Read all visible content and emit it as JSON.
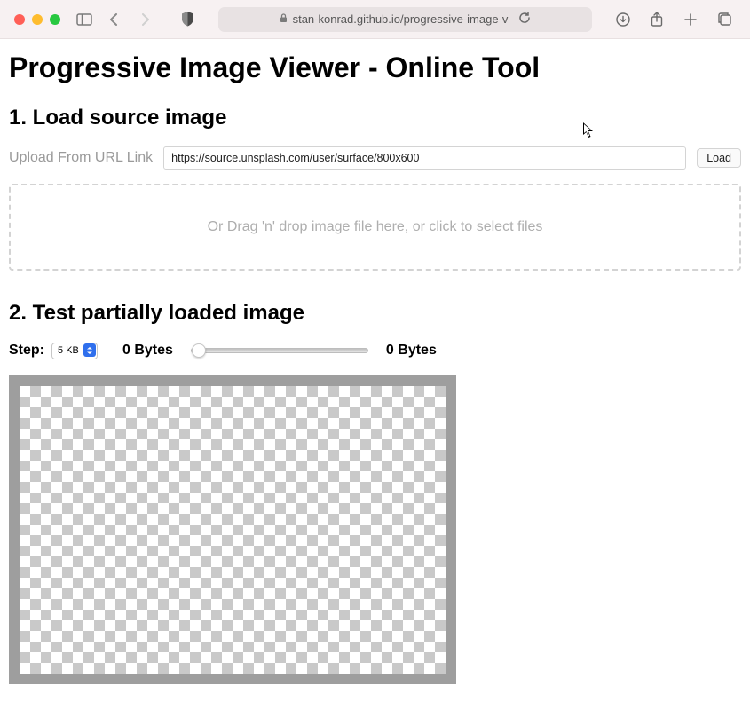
{
  "chrome": {
    "url_display": "stan-konrad.github.io/progressive-image-v"
  },
  "page": {
    "title": "Progressive Image Viewer - Online Tool",
    "section1": {
      "heading": "1. Load source image",
      "url_label": "Upload From URL Link",
      "url_value": "https://source.unsplash.com/user/surface/800x600",
      "load_button": "Load",
      "dropzone_text": "Or Drag 'n' drop image file here, or click to select files"
    },
    "section2": {
      "heading": "2. Test partially loaded image",
      "step_label": "Step:",
      "step_value": "5 KB",
      "bytes_loaded": "0 Bytes",
      "bytes_total": "0 Bytes"
    }
  }
}
